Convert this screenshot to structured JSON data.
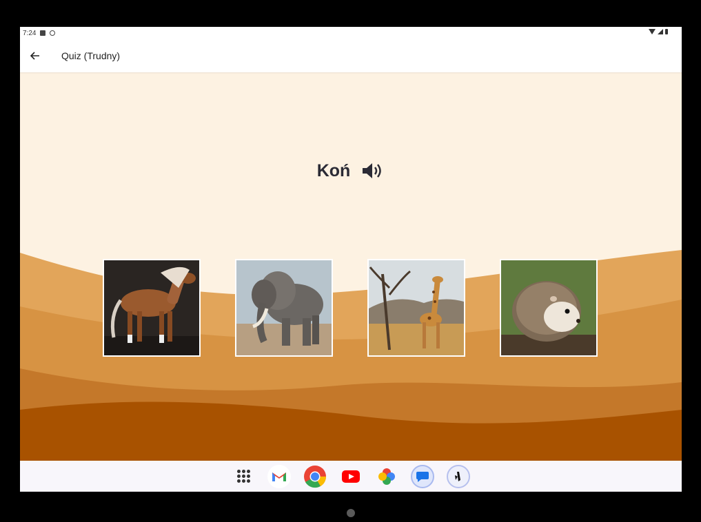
{
  "status_bar": {
    "time": "7:24"
  },
  "app_bar": {
    "back_icon": "arrow-left-icon",
    "title": "Quiz (Trudny)"
  },
  "quiz": {
    "word": "Koń",
    "speaker_icon": "speaker-icon",
    "options": [
      {
        "animal": "horse",
        "icon": "horse-photo"
      },
      {
        "animal": "elephant",
        "icon": "elephant-photo"
      },
      {
        "animal": "giraffe",
        "icon": "giraffe-photo"
      },
      {
        "animal": "hedgehog",
        "icon": "hedgehog-photo"
      }
    ]
  },
  "dock": {
    "apps": [
      "app-drawer-icon",
      "gmail-icon",
      "chrome-icon",
      "youtube-icon",
      "photos-icon",
      "messages-icon",
      "app-icon"
    ]
  },
  "colors": {
    "background_cream": "#fdf2e2",
    "wave_light": "#e2a55a",
    "wave_mid": "#d08a3c",
    "wave_dark": "#a85200",
    "text_dark": "#2b2b35"
  }
}
